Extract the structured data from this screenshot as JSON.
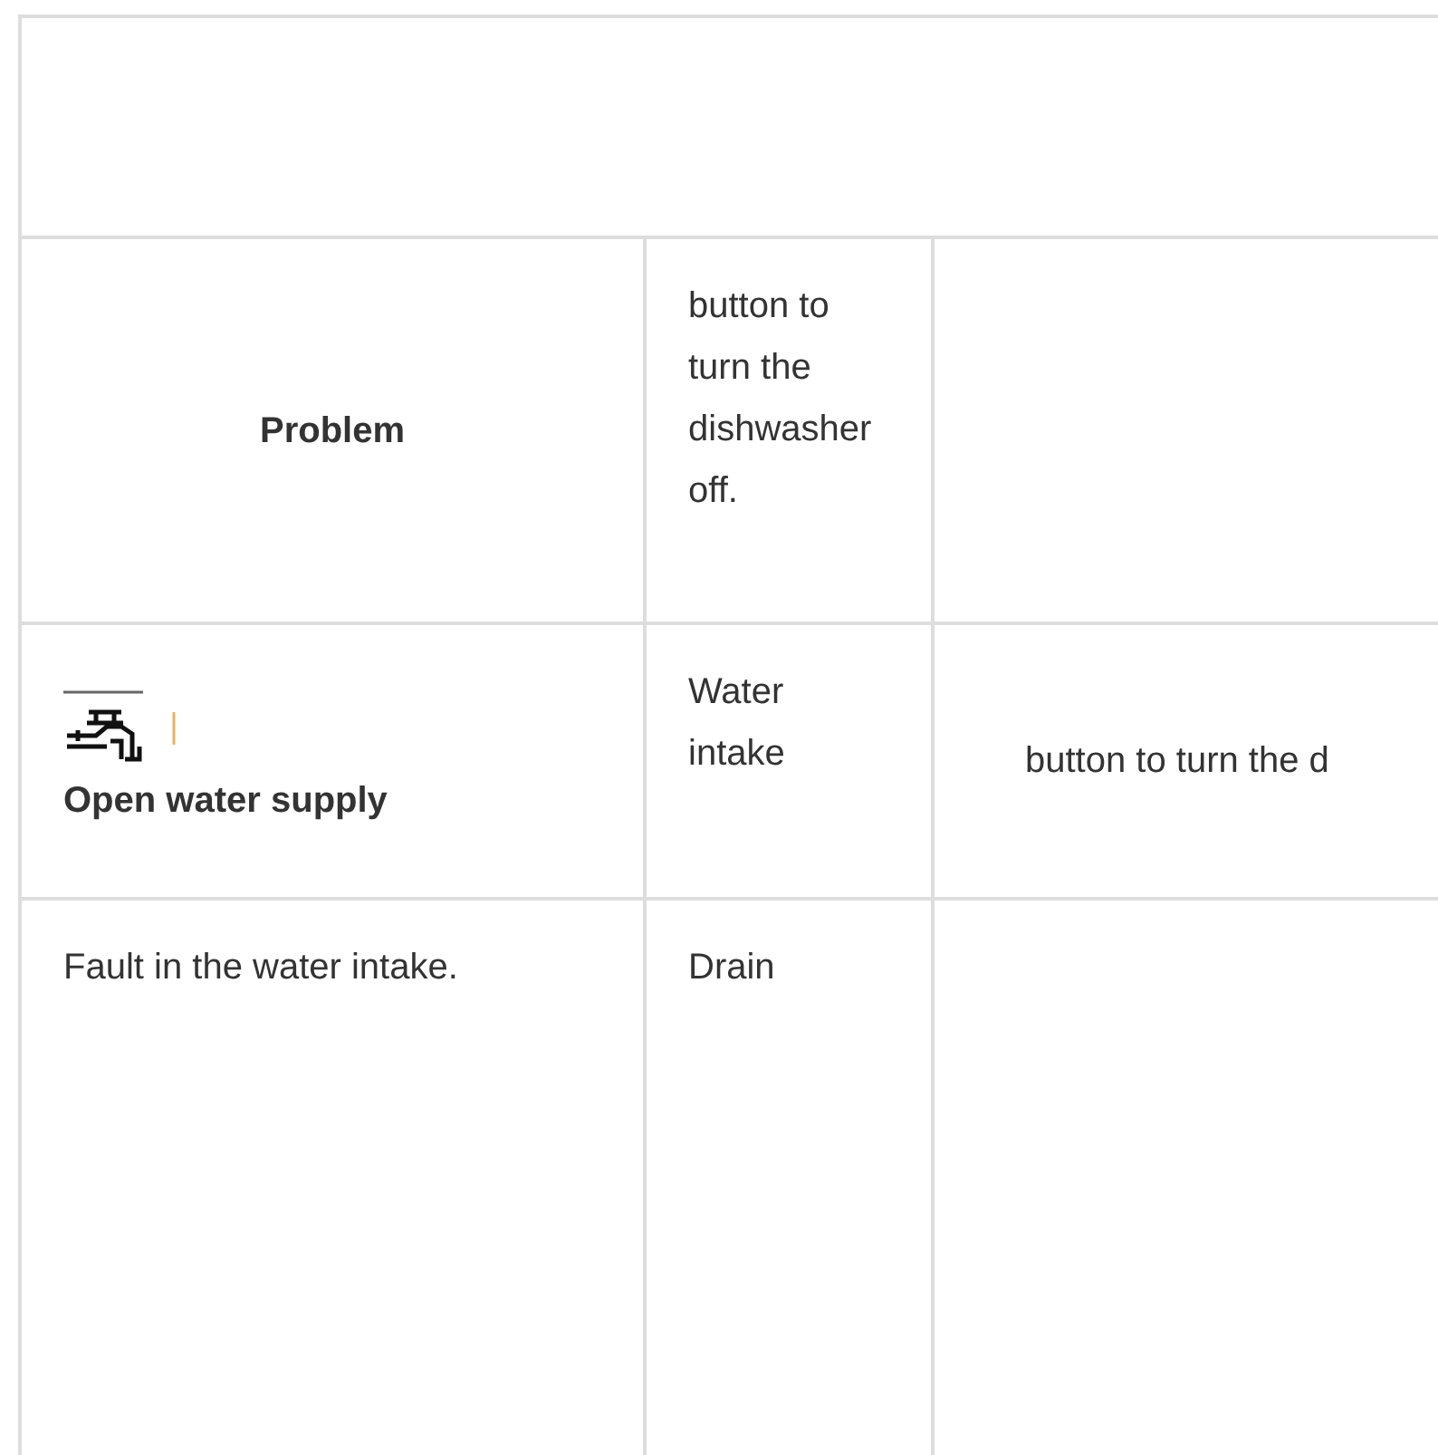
{
  "table": {
    "rows": [
      {
        "column_1": {
          "text": "Problem",
          "bold": true
        },
        "column_2": {
          "text": "button to turn the dishwasher off.",
          "bold": false
        }
      },
      {
        "column_1": {
          "text": "Open water supply",
          "bold": true,
          "icon": true
        },
        "column_2": {
          "text": "Water intake",
          "bold": false
        },
        "column_3": {
          "text": "button to turn the d",
          "bold": false
        }
      },
      {
        "column_1": {
          "text": "Fault in the water intake.",
          "bold": false
        },
        "column_2": {
          "text": "Drain",
          "bold": false
        }
      }
    ]
  }
}
